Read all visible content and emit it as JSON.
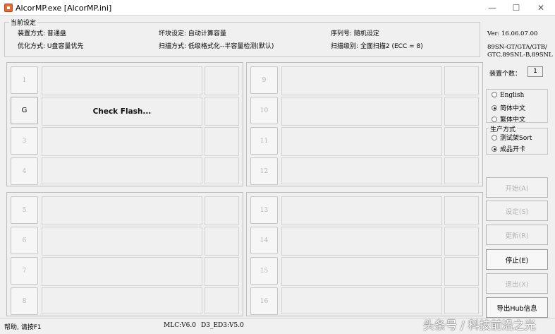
{
  "window": {
    "title": "AlcorMP.exe [AlcorMP.ini]",
    "min_glyph": "—",
    "max_glyph": "☐",
    "close_glyph": "✕"
  },
  "settings": {
    "legend": "当前设定",
    "device_mode": "装置方式: 普通盘",
    "optimize": "优化方式: U盘容量优先",
    "bad_block": "坏块设定: 自动计算容量",
    "scan_mode": "扫描方式: 低级格式化--半容量检测(默认)",
    "serial": "序列号: 随机设定",
    "scan_level": "扫描级别: 全面扫描2 (ECC = 8)"
  },
  "version": {
    "ver": "Ver: 16.06.07.00",
    "chips": "89SN-GT/GTA/GTB/\nGTC,89SNL-B,89SNL"
  },
  "device_count": {
    "label": "装置个数：",
    "value": "1"
  },
  "ports": {
    "p1": "1",
    "p2": "G",
    "p3": "3",
    "p4": "4",
    "p5": "5",
    "p6": "6",
    "p7": "7",
    "p8": "8",
    "p9": "9",
    "p10": "10",
    "p11": "11",
    "p12": "12",
    "p13": "13",
    "p14": "14",
    "p15": "15",
    "p16": "16",
    "active_status": "Check Flash..."
  },
  "language": {
    "english": "English",
    "simplified": "简体中文",
    "traditional": "繁体中文"
  },
  "production": {
    "legend": "生产方式",
    "sort": "测试架Sort",
    "finished": "成品开卡"
  },
  "buttons": {
    "start": "开始(A)",
    "settings": "设定(S)",
    "update": "更新(R)",
    "stop": "停止(E)",
    "exit": "退出(X)",
    "export_hub": "导出Hub信息"
  },
  "status": {
    "help": "帮助, 请按F1",
    "mlc": "MLC:V6.0",
    "d3": "D3_ED3:V5.0"
  },
  "watermark": "头条号 / 科技前沿之光"
}
